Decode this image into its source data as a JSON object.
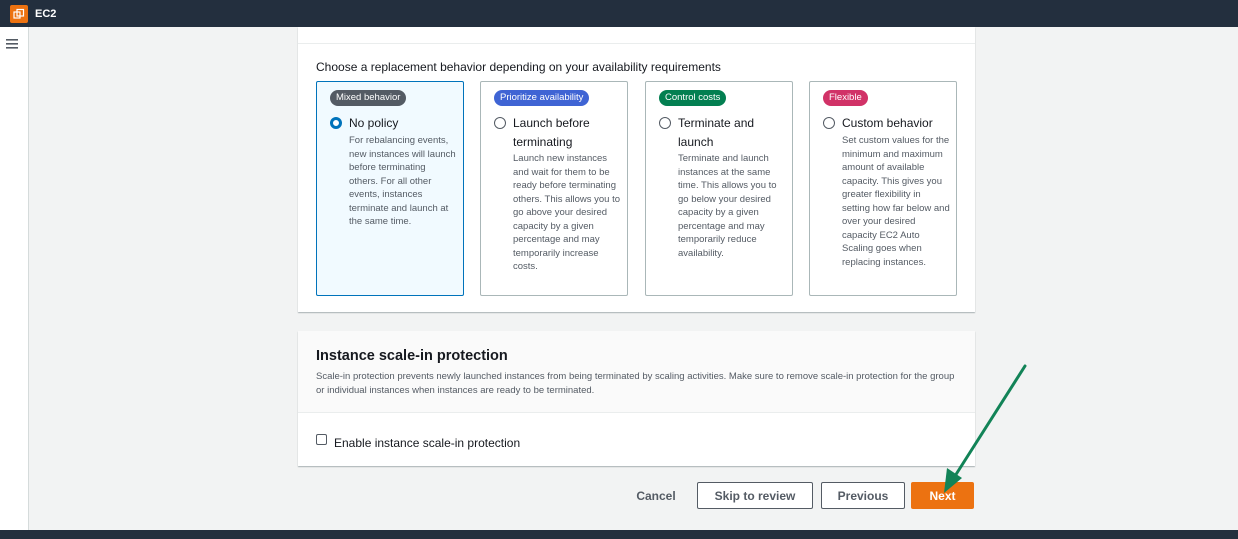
{
  "topbar": {
    "service_label": "EC2"
  },
  "replacement": {
    "intro": "Choose a replacement behavior depending on your availability requirements",
    "options": [
      {
        "badge": "Mixed behavior",
        "badge_color": "#545b64",
        "label": "No policy",
        "selected": true,
        "description": "For rebalancing events, new instances will launch before terminating others. For all other events, instances terminate and launch at the same time."
      },
      {
        "badge": "Prioritize availability",
        "badge_color": "#3f64d4",
        "label": "Launch before terminating",
        "selected": false,
        "description": "Launch new instances and wait for them to be ready before terminating others. This allows you to go above your desired capacity by a given percentage and may temporarily increase costs."
      },
      {
        "badge": "Control costs",
        "badge_color": "#037f51",
        "label": "Terminate and launch",
        "selected": false,
        "description": "Terminate and launch instances at the same time. This allows you to go below your desired capacity by a given percentage and may temporarily reduce availability."
      },
      {
        "badge": "Flexible",
        "badge_color": "#d13267",
        "label": "Custom behavior",
        "selected": false,
        "description": "Set custom values for the minimum and maximum amount of available capacity. This gives you greater flexibility in setting how far below and over your desired capacity EC2 Auto Scaling goes when replacing instances."
      }
    ]
  },
  "scale_in": {
    "title": "Instance scale-in protection",
    "description": "Scale-in protection prevents newly launched instances from being terminated by scaling activities. Make sure to remove scale-in protection for the group or individual instances when instances are ready to be terminated.",
    "checkbox_label": "Enable instance scale-in protection",
    "checked": false
  },
  "footer_buttons": {
    "cancel": "Cancel",
    "skip": "Skip to review",
    "previous": "Previous",
    "next": "Next"
  },
  "colors": {
    "primary": "#ec7211",
    "selected_border": "#0073bb",
    "annotation_arrow": "#128357"
  }
}
